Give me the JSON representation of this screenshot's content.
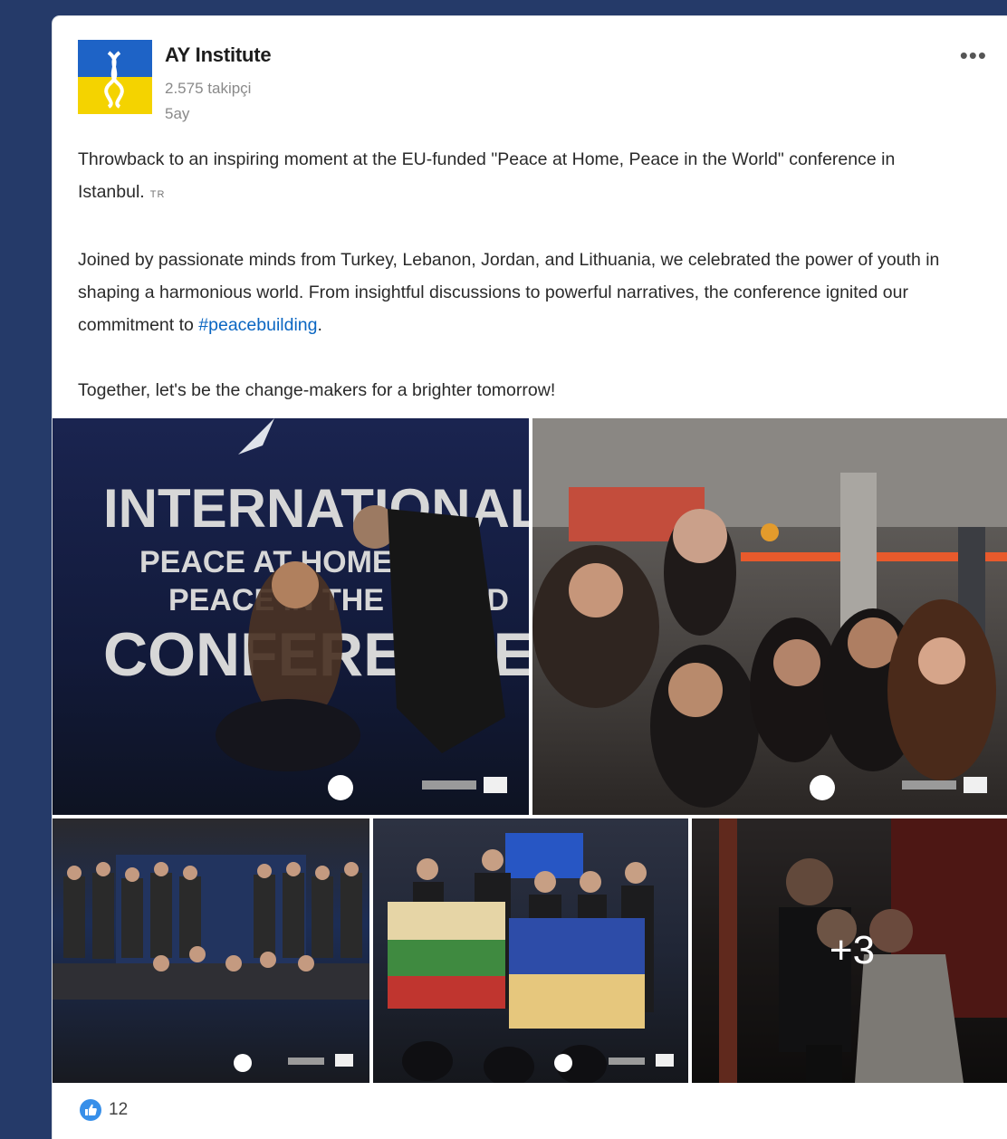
{
  "post": {
    "author": "AY Institute",
    "followers": "2.575 takipçi",
    "time": "5ay",
    "menu_label": "•••",
    "text": {
      "p1": "Throwback to an inspiring moment at the EU-funded \"Peace at Home, Peace in the World\" conference in Istanbul.",
      "translate": "TR",
      "p2_before": "Joined by passionate minds from Turkey, Lebanon, Jordan, and Lithuania, we celebrated the power of youth in shaping a harmonious world. From insightful discussions to powerful narratives, the conference ignited our commitment to ",
      "hashtag": "#peacebuilding",
      "p2_after": ".",
      "p3": "Together, let's be the change-makers for a brighter tomorrow!"
    },
    "images": {
      "banner_line1": "INTERNATIONAL",
      "banner_line2": "PEACE AT HOME,",
      "banner_line3": "PEACE IN THE WORLD",
      "banner_line4": "CONFERENCE",
      "more_count": "+3"
    },
    "reactions": {
      "count": "12"
    },
    "colors": {
      "background": "#253a69",
      "link": "#0a66c2",
      "like": "#378fe9"
    }
  }
}
